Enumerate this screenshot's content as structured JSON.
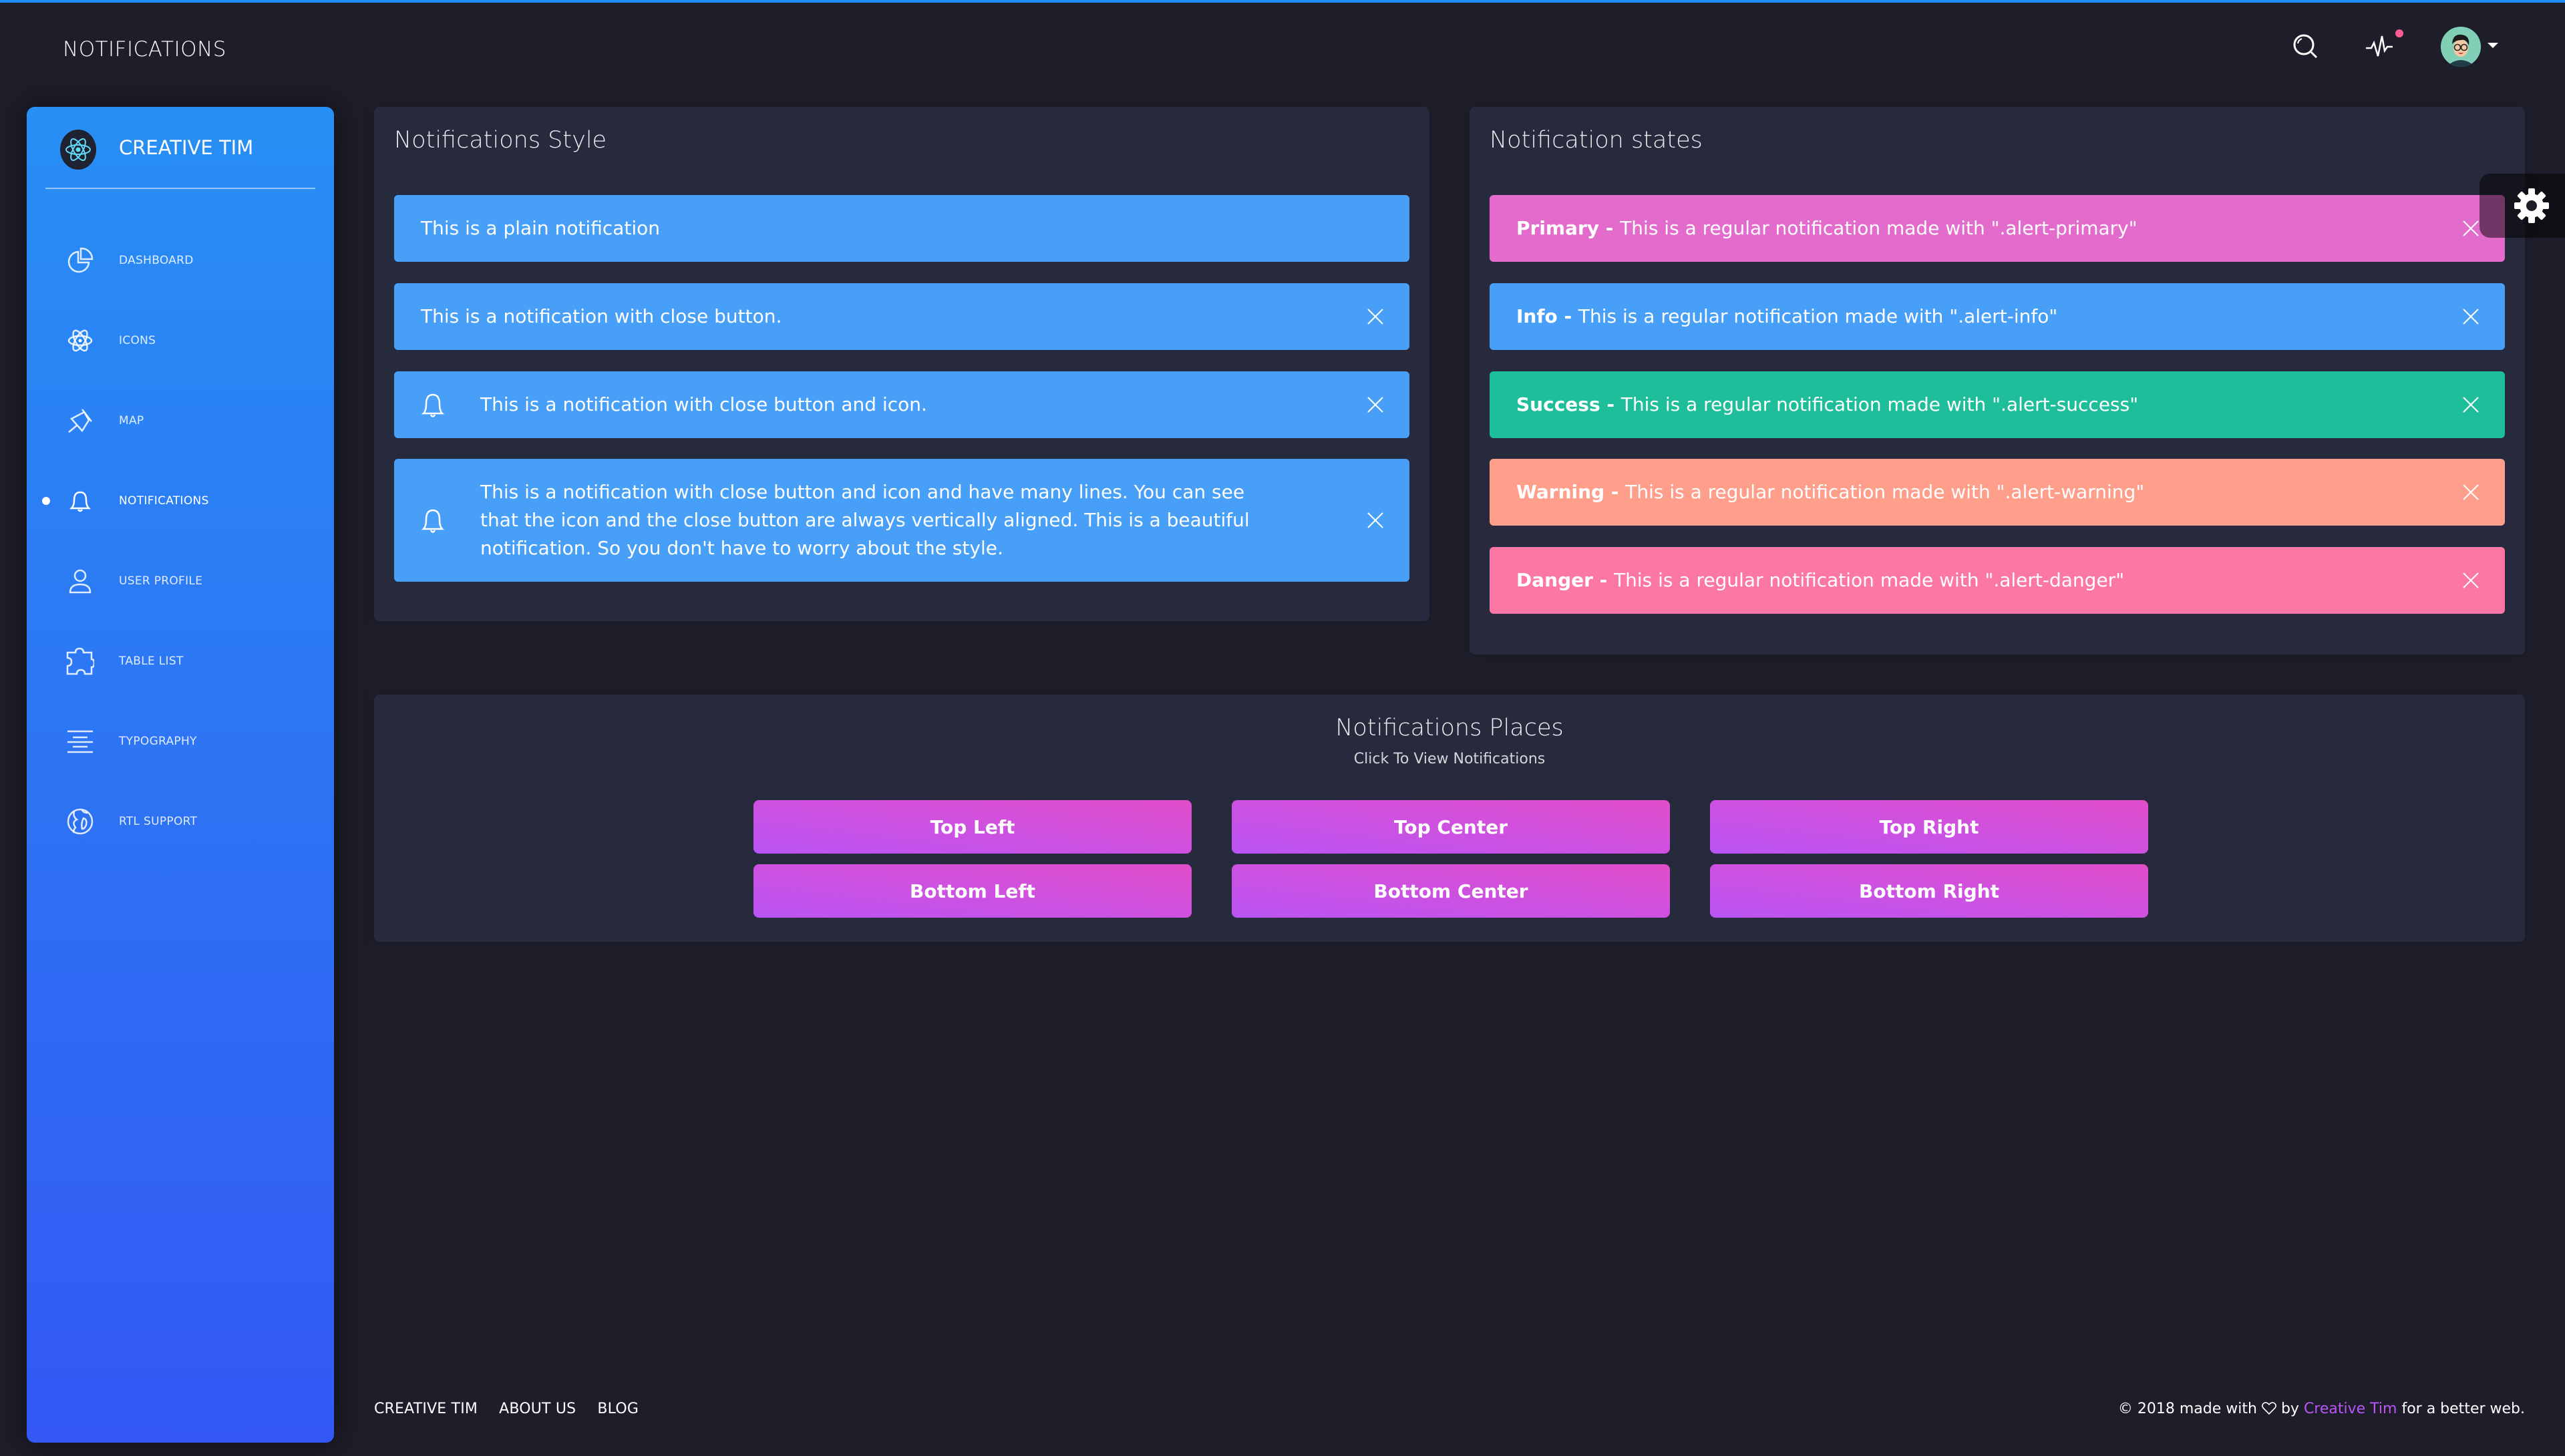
{
  "header": {
    "title": "NOTIFICATIONS",
    "icons": [
      "search-icon",
      "activity-icon",
      "avatar",
      "caret-down-icon"
    ],
    "activity_badge_color": "#fd5d93"
  },
  "sidebar": {
    "brand": "CREATIVE TIM",
    "items": [
      {
        "label": "DASHBOARD",
        "icon": "chart-pie-icon",
        "active": false
      },
      {
        "label": "ICONS",
        "icon": "atom-icon",
        "active": false
      },
      {
        "label": "MAP",
        "icon": "pin-icon",
        "active": false
      },
      {
        "label": "NOTIFICATIONS",
        "icon": "bell-icon",
        "active": true
      },
      {
        "label": "USER PROFILE",
        "icon": "user-icon",
        "active": false
      },
      {
        "label": "TABLE LIST",
        "icon": "puzzle-icon",
        "active": false
      },
      {
        "label": "TYPOGRAPHY",
        "icon": "align-center-icon",
        "active": false
      },
      {
        "label": "RTL SUPPORT",
        "icon": "world-icon",
        "active": false
      }
    ],
    "gradient": [
      "#288ff4",
      "#3358f4"
    ]
  },
  "styles_card": {
    "title": "Notifications Style",
    "alerts": [
      {
        "text": "This is a plain notification",
        "close": false,
        "icon": false
      },
      {
        "text": "This is a notification with close button.",
        "close": true,
        "icon": false
      },
      {
        "text": "This is a notification with close button and icon.",
        "close": true,
        "icon": true
      },
      {
        "text": "This is a notification with close button and icon and have many lines. You can see that the icon and the close button are always vertically aligned. This is a beautiful notification. So you don't have to worry about the style.",
        "close": true,
        "icon": true
      }
    ],
    "color": "#479ff8"
  },
  "states_card": {
    "title": "Notification states",
    "alerts": [
      {
        "label": "Primary - ",
        "text": "This is a regular notification made with \".alert-primary\"",
        "color": "#e26bcc"
      },
      {
        "label": "Info - ",
        "text": "This is a regular notification made with \".alert-info\"",
        "color": "#479ff8"
      },
      {
        "label": "Success - ",
        "text": "This is a regular notification made with \".alert-success\"",
        "color": "#1fbe9a"
      },
      {
        "label": "Warning - ",
        "text": "This is a regular notification made with \".alert-warning\"",
        "color": "#ff9e8a"
      },
      {
        "label": "Danger - ",
        "text": "This is a regular notification made with \".alert-danger\"",
        "color": "#fd77a4"
      }
    ]
  },
  "places_card": {
    "title": "Notifications Places",
    "subtitle": "Click To View Notifications",
    "buttons": [
      "Top Left",
      "Top Center",
      "Top Right",
      "Bottom Left",
      "Bottom Center",
      "Bottom Right"
    ]
  },
  "footer": {
    "links": [
      "CREATIVE TIM",
      "ABOUT US",
      "BLOG"
    ],
    "copyright_prefix": "© 2018 made with",
    "copyright_by": "by",
    "copyright_link": "Creative Tim",
    "copyright_suffix": "for a better web."
  }
}
